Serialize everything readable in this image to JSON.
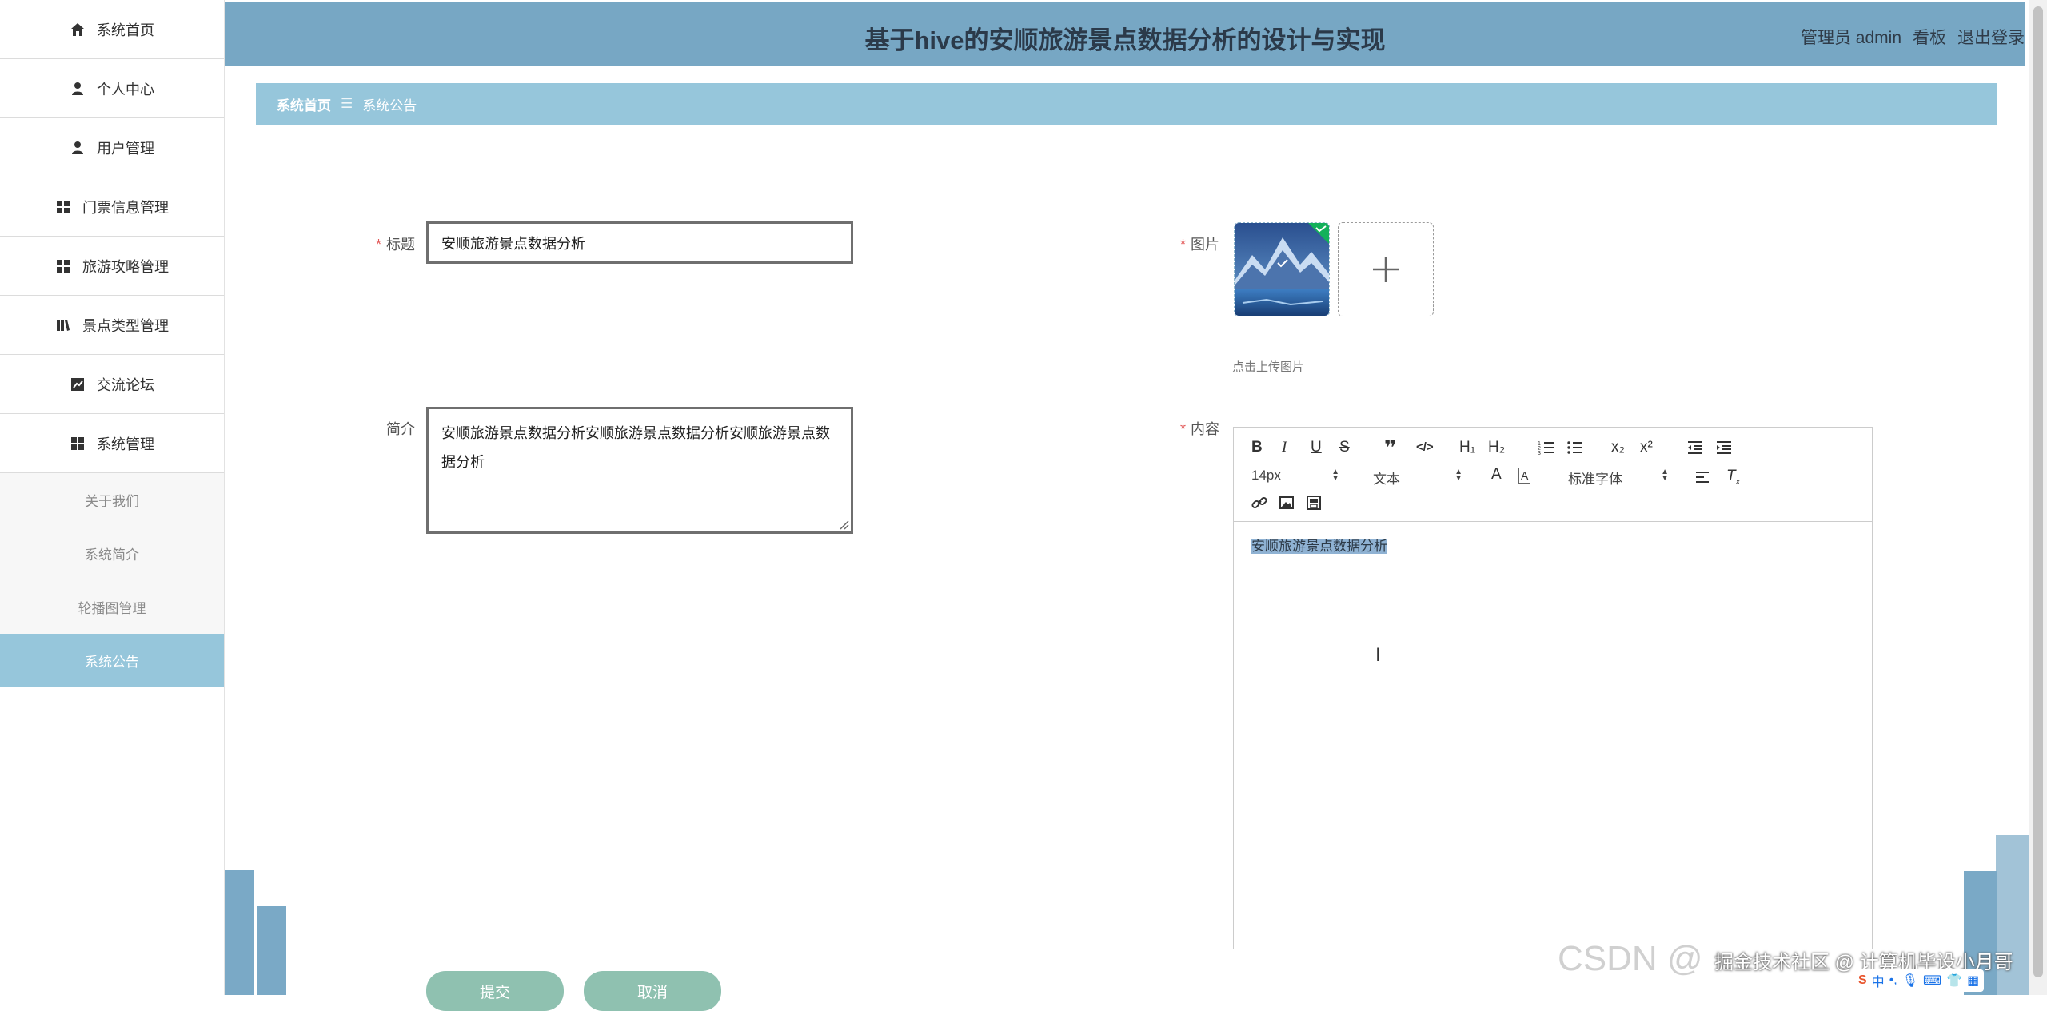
{
  "app": {
    "title": "基于hive的安顺旅游景点数据分析的设计与实现",
    "user_label": "管理员 admin",
    "dashboard_label": "看板",
    "logout_label": "退出登录"
  },
  "sidebar": {
    "items": [
      {
        "label": "系统首页",
        "icon": "home-icon"
      },
      {
        "label": "个人中心",
        "icon": "user-icon"
      },
      {
        "label": "用户管理",
        "icon": "user-icon"
      },
      {
        "label": "门票信息管理",
        "icon": "grid-icon"
      },
      {
        "label": "旅游攻略管理",
        "icon": "grid-icon"
      },
      {
        "label": "景点类型管理",
        "icon": "library-icon"
      },
      {
        "label": "交流论坛",
        "icon": "chart-icon"
      },
      {
        "label": "系统管理",
        "icon": "grid-icon"
      }
    ],
    "sub_items": [
      {
        "label": "关于我们"
      },
      {
        "label": "系统简介"
      },
      {
        "label": "轮播图管理"
      },
      {
        "label": "系统公告",
        "active": true
      }
    ]
  },
  "breadcrumb": {
    "home": "系统首页",
    "separator": "☰",
    "current": "系统公告"
  },
  "form": {
    "title_label": "标题",
    "title_value": "安顺旅游景点数据分析",
    "summary_label": "简介",
    "summary_value": "安顺旅游景点数据分析安顺旅游景点数据分析安顺旅游景点数据分析",
    "image_label": "图片",
    "upload_hint": "点击上传图片",
    "content_label": "内容",
    "content_value": "安顺旅游景点数据分析",
    "submit_label": "提交",
    "cancel_label": "取消"
  },
  "editor": {
    "font_size": "14px",
    "text_type": "文本",
    "font_family": "标准字体",
    "h1": "H₁",
    "h2": "H₂",
    "sub": "x₂",
    "sup": "x²"
  },
  "watermark": {
    "csdn": "CSDN @",
    "community": "掘金技术社区 @ 计算机毕设小月哥"
  },
  "colors": {
    "header_bg": "#77a7c4",
    "breadcrumb_bg": "#96c6db",
    "active_sidebar_bg": "#96c6db",
    "button_bg": "#8fc1b0",
    "required_star": "#e25656"
  }
}
